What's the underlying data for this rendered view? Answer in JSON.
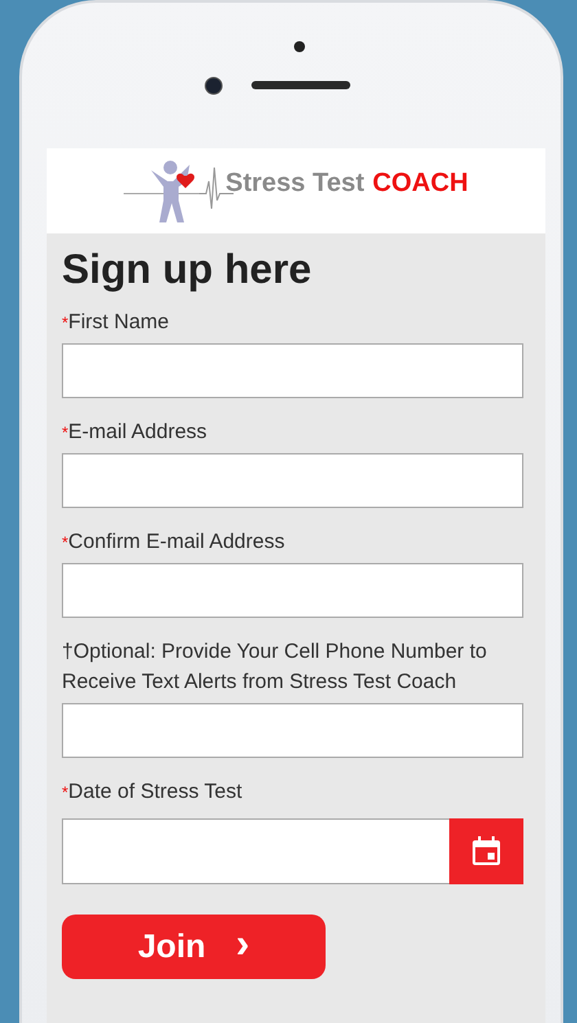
{
  "logo": {
    "text": "Stress Test",
    "accent": "COACH"
  },
  "title": "Sign up here",
  "fields": [
    {
      "kind": "text",
      "label": "First Name",
      "required": true
    },
    {
      "kind": "text",
      "label": "E-mail Address",
      "required": true
    },
    {
      "kind": "text",
      "label": "Confirm E-mail Address",
      "required": true
    },
    {
      "kind": "text",
      "label": "†Optional: Provide Your Cell Phone Number to Receive Text Alerts from Stress Test Coach",
      "required": false
    },
    {
      "kind": "date",
      "label": "Date of Stress Test",
      "required": true
    }
  ],
  "required_mark": "*",
  "submit": {
    "label": "Join",
    "icon": "›"
  }
}
